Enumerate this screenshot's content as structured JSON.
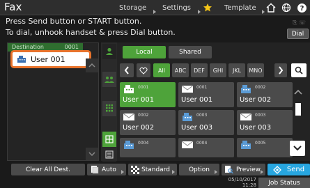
{
  "topbar": {
    "title": "Fax",
    "tabs": [
      "Storage",
      "Settings",
      "Template"
    ]
  },
  "messages": {
    "line1": "Press Send button or START button.",
    "line2": "To dial, unhook handset & press Dial button.",
    "dial_label": "Dial"
  },
  "destination": {
    "header": "Destination",
    "count": "0001",
    "selected": "User 001"
  },
  "address_book": {
    "local_label": "Local",
    "shared_label": "Shared",
    "filters": [
      "All",
      "ABC",
      "DEF",
      "GHI",
      "JKL",
      "MNO"
    ],
    "entries": [
      {
        "num": "0001",
        "name": "User 001",
        "type": "fax",
        "selected": true
      },
      {
        "num": "0001",
        "name": "User 001",
        "type": "email",
        "selected": false
      },
      {
        "num": "0002",
        "name": "User 002",
        "type": "fax",
        "selected": false
      },
      {
        "num": "0002",
        "name": "User 002",
        "type": "email",
        "selected": false
      },
      {
        "num": "0003",
        "name": "User 003",
        "type": "fax",
        "selected": false
      },
      {
        "num": "0003",
        "name": "User 003",
        "type": "email",
        "selected": false
      },
      {
        "num": "0004",
        "name": "",
        "type": "fax",
        "selected": false
      },
      {
        "num": "0004",
        "name": "",
        "type": "email",
        "selected": false
      },
      {
        "num": "0005",
        "name": "",
        "type": "fax",
        "selected": false
      }
    ]
  },
  "bottom": {
    "clear_label": "Clear All Dest.",
    "auto_label": "Auto",
    "standard_label": "Standard",
    "option_label": "Option",
    "preview_label": "Preview",
    "send_label": "Send",
    "date": "05/10/2017",
    "time": "11:28",
    "job_status_label": "Job Status"
  },
  "colors": {
    "accent_green": "#4ea33a",
    "highlight_orange": "#e8732c",
    "send_blue": "#27a6e0"
  }
}
